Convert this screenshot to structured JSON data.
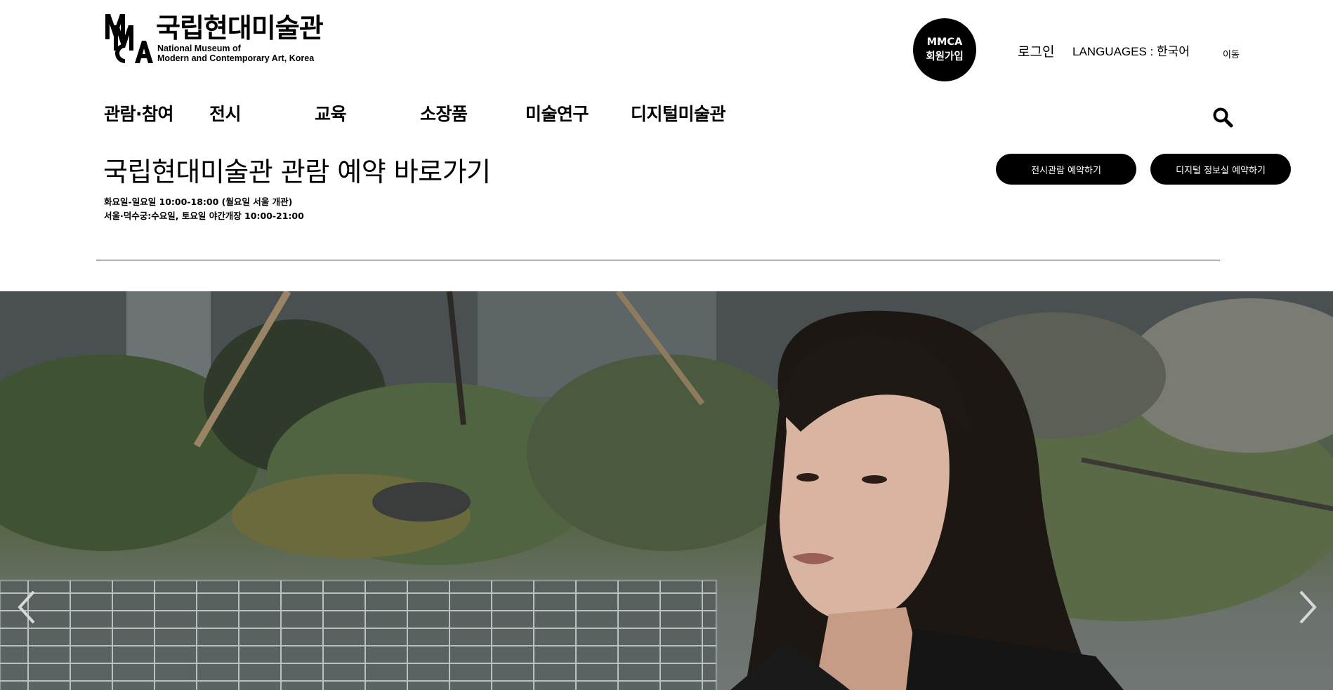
{
  "logo": {
    "korean": "국립현대미술관",
    "english_line1": "National Museum of",
    "english_line2": "Modern and Contemporary Art, Korea"
  },
  "membership": {
    "line1": "MMCA",
    "line2": "회원가입"
  },
  "utility": {
    "login": "로그인",
    "languages_label": "LANGUAGES : ",
    "languages_value": "한국어",
    "go": "이동"
  },
  "gnb": {
    "items": [
      "관람·참여",
      "전시",
      "교육",
      "소장품",
      "미술연구",
      "디지털미술관"
    ]
  },
  "reservation": {
    "title": "국립현대미술관 관람 예약 바로가기",
    "hours_line1": "화요일-일요일 10:00-18:00 (월요일 서울 개관)",
    "hours_line2": "서울·덕수궁:수요일, 토요일 야간개장 10:00-21:00",
    "exhibition_button": "전시관람 예약하기",
    "digital_button": "디지털 정보실 예약하기"
  },
  "hero": {
    "prev_icon": "chevron-left-icon",
    "next_icon": "chevron-right-icon"
  },
  "colors": {
    "text": "#000000",
    "button_bg": "#000000",
    "button_text": "#ffffff",
    "divider": "#333333"
  }
}
